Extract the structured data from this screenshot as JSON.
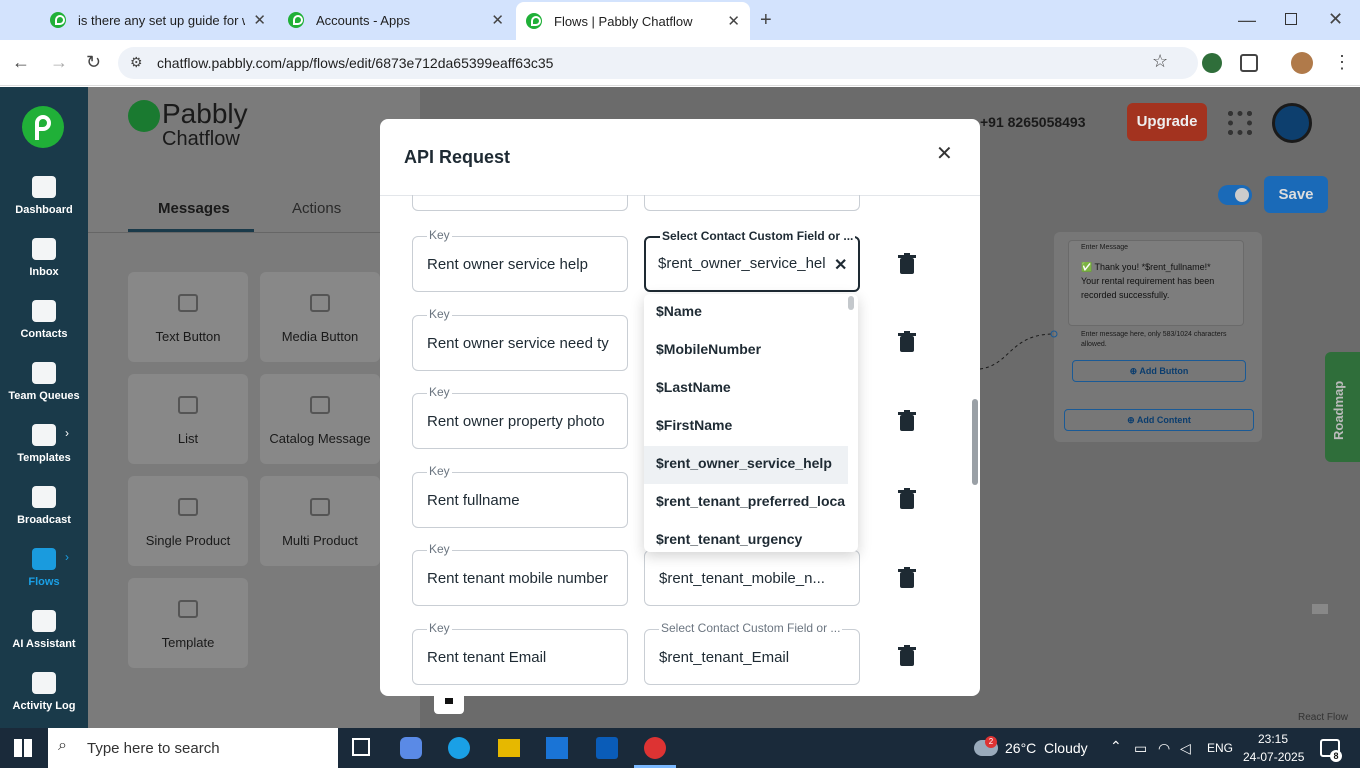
{
  "browser": {
    "tabs": [
      {
        "title": "is there any set up guide for we"
      },
      {
        "title": "Accounts - Apps"
      },
      {
        "title": "Flows | Pabbly Chatflow"
      }
    ],
    "url": "chatflow.pabbly.com/app/flows/edit/6873e712da65399eaff63c35"
  },
  "app": {
    "logo_line1": "Pabbly",
    "logo_line2": "Chatflow",
    "header": {
      "whatsapp_number": "+91 8265058493",
      "upgrade": "Upgrade",
      "save": "Save"
    },
    "sidebar": [
      {
        "label": "Dashboard"
      },
      {
        "label": "Inbox"
      },
      {
        "label": "Contacts"
      },
      {
        "label": "Team Queues"
      },
      {
        "label": "Templates"
      },
      {
        "label": "Broadcast"
      },
      {
        "label": "Flows"
      },
      {
        "label": "AI Assistant"
      },
      {
        "label": "Activity Log"
      }
    ],
    "panel_tabs": [
      "Messages",
      "Actions"
    ],
    "tiles": [
      "Text Button",
      "Media Button",
      "List",
      "Catalog Message",
      "Single Product",
      "Multi Product",
      "Template"
    ],
    "canvas": {
      "enter_message": "Enter Message",
      "message_text": "✅ Thank you! *$rent_fullname!* Your rental requirement has been recorded successfully.",
      "char_hint": "Enter message here, only 583/1024 characters allowed.",
      "add_button": "Add Button",
      "add_content": "Add Content",
      "roadmap": "Roadmap",
      "react_flow": "React Flow"
    }
  },
  "modal": {
    "title": "API Request",
    "rows": [
      {
        "key_label": "Key",
        "key": "Rent owner service help",
        "value_label": "Select Contact Custom Field or ...",
        "value": "$rent_owner_service_hel"
      },
      {
        "key_label": "Key",
        "key": "Rent owner service need ty",
        "value_label": "",
        "value": ""
      },
      {
        "key_label": "Key",
        "key": "Rent owner property photo",
        "value_label": "",
        "value": ""
      },
      {
        "key_label": "Key",
        "key": "Rent  fullname",
        "value_label": "",
        "value": ""
      },
      {
        "key_label": "Key",
        "key": "Rent tenant mobile number",
        "value_label": "",
        "value": "$rent_tenant_mobile_n..."
      },
      {
        "key_label": "Key",
        "key": "Rent tenant Email",
        "value_label": "Select Contact Custom Field or ...",
        "value": "$rent_tenant_Email"
      }
    ],
    "dropdown": [
      "$Name",
      "$MobileNumber",
      "$LastName",
      "$FirstName",
      "$rent_owner_service_help",
      "$rent_tenant_preferred_loca",
      "$rent_tenant_urgency"
    ]
  },
  "taskbar": {
    "search_placeholder": "Type here to search",
    "weather": "26°C  Cloudy",
    "lang": "ENG",
    "time": "23:15",
    "date": "24-07-2025",
    "notif_count": "8",
    "weather_badge": "2"
  }
}
